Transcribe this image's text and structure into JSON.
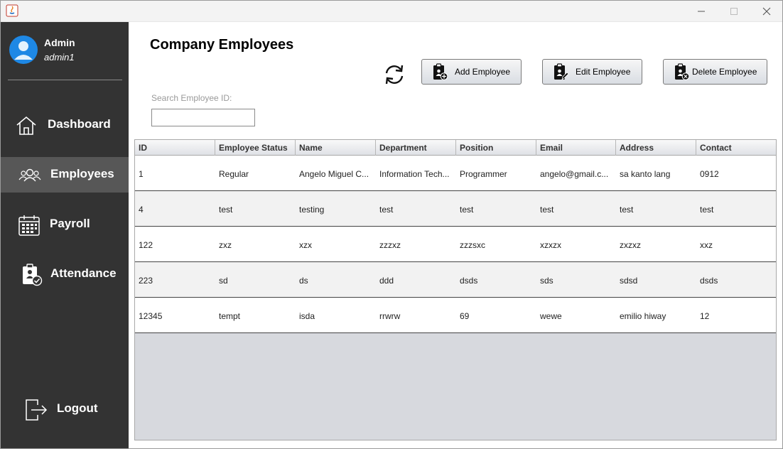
{
  "window": {
    "app_icon": "java-icon",
    "controls": [
      "minimize-icon",
      "maximize-icon",
      "close-icon"
    ]
  },
  "sidebar": {
    "user": {
      "name": "Admin",
      "username": "admin1",
      "avatar_color": "#1e88e5"
    },
    "items": [
      {
        "label": "Dashboard",
        "icon": "home-icon",
        "active": false
      },
      {
        "label": "Employees",
        "icon": "users-icon",
        "active": true
      },
      {
        "label": "Payroll",
        "icon": "calendar-icon",
        "active": false
      },
      {
        "label": "Attendance",
        "icon": "badge-check-icon",
        "active": false
      }
    ],
    "logout": {
      "label": "Logout",
      "icon": "logout-icon"
    }
  },
  "main": {
    "title": "Company Employees",
    "toolbar": {
      "refresh_icon": "refresh-icon",
      "add_label": "Add Employee",
      "edit_label": "Edit Employee",
      "delete_label": "Delete Employee"
    },
    "search": {
      "label": "Search Employee ID:",
      "value": "",
      "placeholder": ""
    },
    "table": {
      "columns": [
        "ID",
        "Employee Status",
        "Name",
        "Department",
        "Position",
        "Email",
        "Address",
        "Contact"
      ],
      "rows": [
        [
          "1",
          "Regular",
          "Angelo Miguel C...",
          "Information Tech...",
          "Programmer",
          "angelo@gmail.c...",
          "sa kanto lang",
          "0912"
        ],
        [
          "4",
          "test",
          "testing",
          "test",
          "test",
          "test",
          "test",
          "test"
        ],
        [
          "122",
          "zxz",
          "xzx",
          "zzzxz",
          "zzzsxc",
          "xzxzx",
          "zxzxz",
          "xxz"
        ],
        [
          "223",
          "sd",
          "ds",
          "ddd",
          "dsds",
          "sds",
          "sdsd",
          "dsds"
        ],
        [
          "12345",
          "tempt",
          "isda",
          "rrwrw",
          "69",
          "wewe",
          "emilio hiway",
          "12"
        ]
      ]
    }
  },
  "colors": {
    "sidebar_bg": "#333333",
    "sidebar_active": "#575757",
    "table_empty_bg": "#d7d9de"
  }
}
